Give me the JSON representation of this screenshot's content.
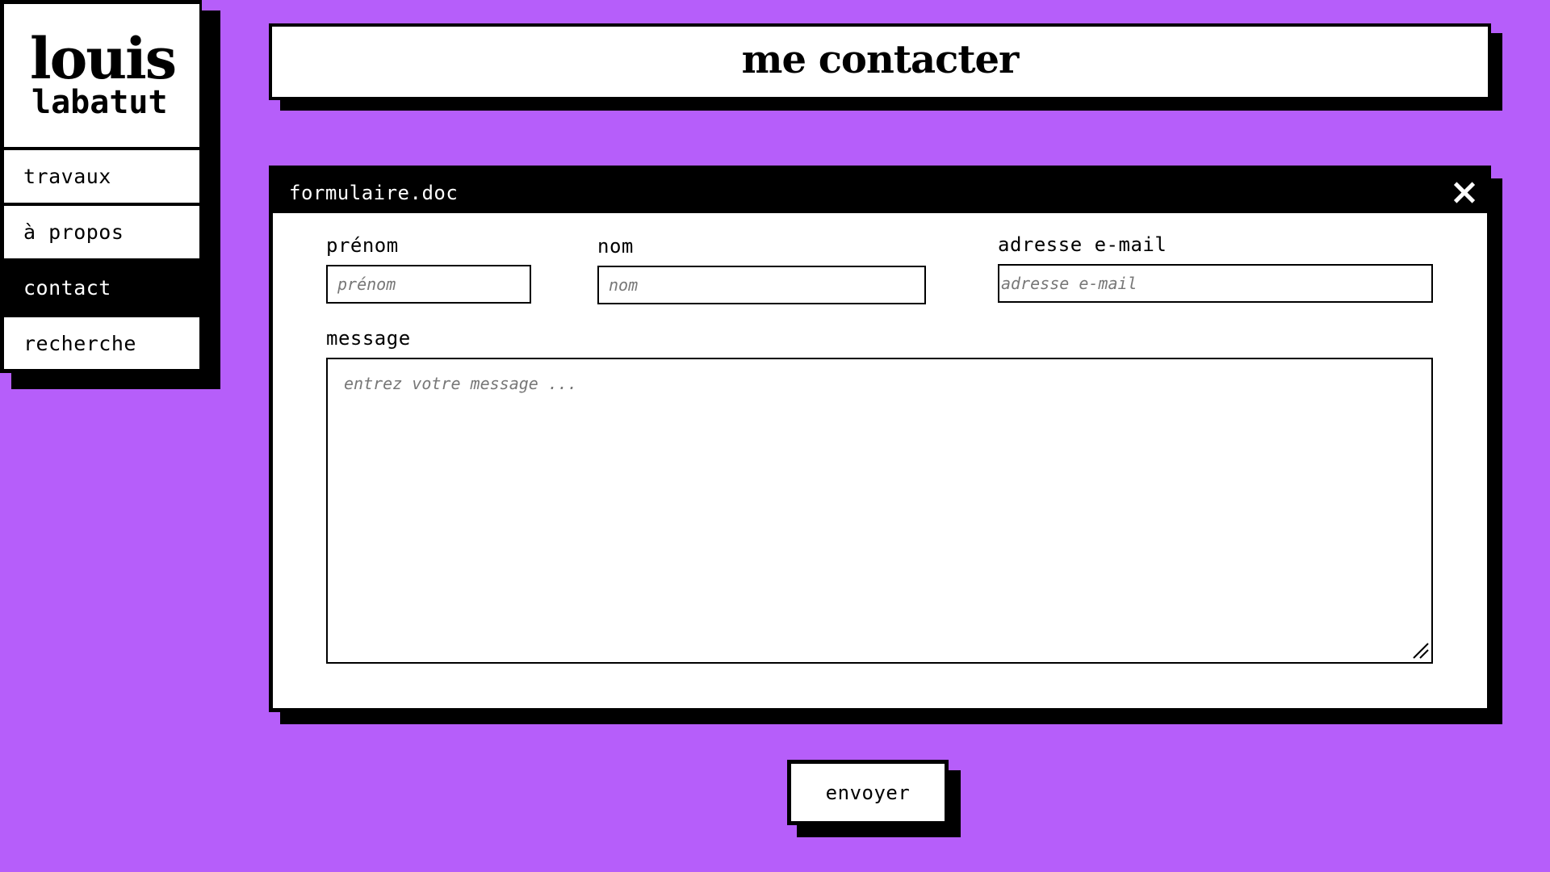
{
  "brand": {
    "first_name": "louis",
    "last_name": "labatut"
  },
  "sidebar": {
    "items": [
      {
        "label": "travaux",
        "active": false
      },
      {
        "label": "à propos",
        "active": false
      },
      {
        "label": "contact",
        "active": true
      },
      {
        "label": "recherche",
        "active": false
      }
    ]
  },
  "header": {
    "title": "me contacter"
  },
  "window": {
    "title": "formulaire.doc",
    "close_icon": "close-icon"
  },
  "form": {
    "first_name": {
      "label": "prénom",
      "placeholder": "prénom",
      "value": ""
    },
    "last_name": {
      "label": "nom",
      "placeholder": "nom",
      "value": ""
    },
    "email": {
      "label": "adresse e-mail",
      "placeholder": "adresse e-mail",
      "value": ""
    },
    "message": {
      "label": "message",
      "placeholder": "entrez votre message ...",
      "value": ""
    },
    "submit_label": "envoyer"
  },
  "colors": {
    "background": "#b65efa",
    "ink": "#000000",
    "surface": "#ffffff"
  }
}
